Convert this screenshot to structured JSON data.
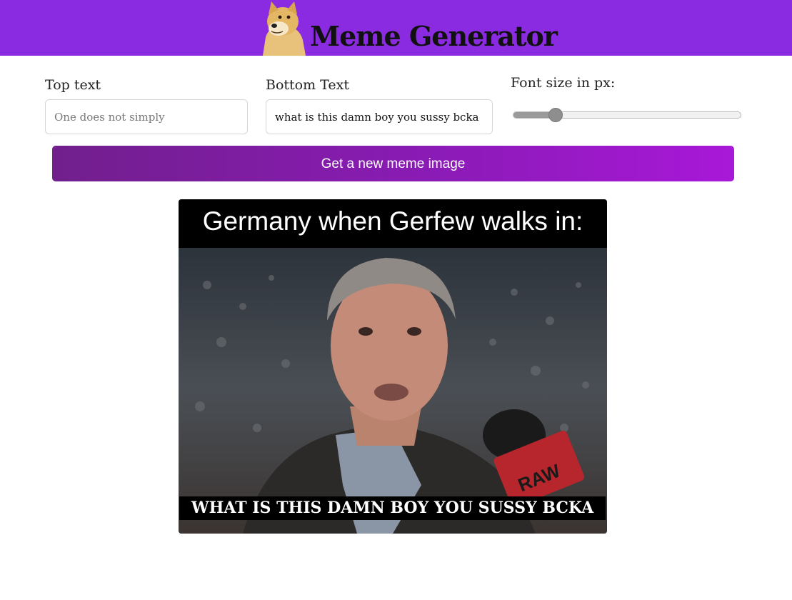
{
  "header": {
    "title": "Meme Generator",
    "logo_icon": "doge-icon",
    "background": "#8a2be2"
  },
  "form": {
    "top_text": {
      "label": "Top text",
      "placeholder": "One does not simply",
      "value": ""
    },
    "bottom_text": {
      "label": "Bottom Text",
      "placeholder": "",
      "value": "what is this damn boy you sussy bcka"
    },
    "font_size": {
      "label": "Font size in px:",
      "fraction": 0.185
    },
    "generate_button": {
      "label": "Get a new meme image"
    }
  },
  "meme": {
    "image_caption": "Germany when Gerfew walks in:",
    "top_overlay": "",
    "bottom_overlay": "WHAT IS THIS DAMN BOY YOU SUSSY BCKA"
  },
  "colors": {
    "accent": "#8a2be2",
    "button_start": "#711f8d",
    "button_end": "#a818d8"
  }
}
